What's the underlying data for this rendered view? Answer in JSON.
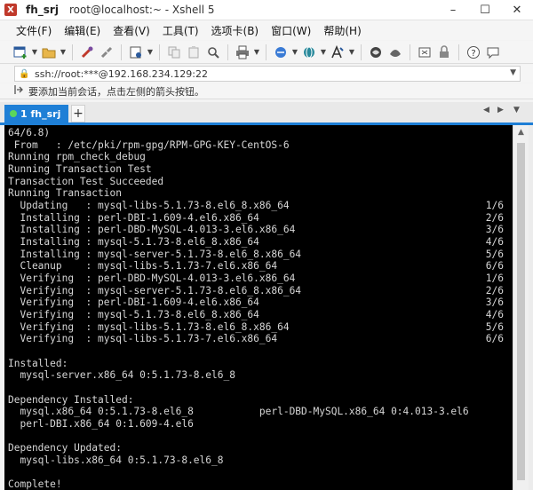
{
  "titlebar": {
    "session": "fh_srj",
    "title": "root@localhost:~ - Xshell 5",
    "minimize": "–",
    "maximize": "☐",
    "close": "✕"
  },
  "menubar": [
    "文件(F)",
    "编辑(E)",
    "查看(V)",
    "工具(T)",
    "选项卡(B)",
    "窗口(W)",
    "帮助(H)"
  ],
  "toolbar": {
    "icons": [
      "new-session-icon",
      "open-folder-icon",
      "reconnect-icon",
      "disconnect-icon",
      "properties-icon",
      "copy-icon",
      "paste-icon",
      "find-icon",
      "print-icon",
      "transfer-icon",
      "globe-icon",
      "font-icon",
      "xftp-icon",
      "xagent-icon",
      "fullscreen-icon",
      "lock-icon",
      "help-icon",
      "chat-icon"
    ]
  },
  "address": {
    "value": "ssh://root:***@192.168.234.129:22"
  },
  "hint": {
    "text": "要添加当前会话，点击左侧的箭头按钮。"
  },
  "tabs": {
    "active_label": "1 fh_srj",
    "add": "+",
    "prev": "◀",
    "next": "▶",
    "menu": "▼"
  },
  "terminal": {
    "lines": [
      "64/6.8)",
      " From   : /etc/pki/rpm-gpg/RPM-GPG-KEY-CentOS-6",
      "Running rpm_check_debug",
      "Running Transaction Test",
      "Transaction Test Succeeded",
      "Running Transaction",
      "  Updating   : mysql-libs-5.1.73-8.el6_8.x86_64",
      "  Installing : perl-DBI-1.609-4.el6.x86_64",
      "  Installing : perl-DBD-MySQL-4.013-3.el6.x86_64",
      "  Installing : mysql-5.1.73-8.el6_8.x86_64",
      "  Installing : mysql-server-5.1.73-8.el6_8.x86_64",
      "  Cleanup    : mysql-libs-5.1.73-7.el6.x86_64",
      "  Verifying  : perl-DBD-MySQL-4.013-3.el6.x86_64",
      "  Verifying  : mysql-server-5.1.73-8.el6_8.x86_64",
      "  Verifying  : perl-DBI-1.609-4.el6.x86_64",
      "  Verifying  : mysql-5.1.73-8.el6_8.x86_64",
      "  Verifying  : mysql-libs-5.1.73-8.el6_8.x86_64",
      "  Verifying  : mysql-libs-5.1.73-7.el6.x86_64",
      "",
      "Installed:",
      "  mysql-server.x86_64 0:5.1.73-8.el6_8",
      "",
      "Dependency Installed:",
      "  mysql.x86_64 0:5.1.73-8.el6_8           perl-DBD-MySQL.x86_64 0:4.013-3.el6",
      "  perl-DBI.x86_64 0:1.609-4.el6",
      "",
      "Dependency Updated:",
      "  mysql-libs.x86_64 0:5.1.73-8.el6_8",
      "",
      "Complete!"
    ],
    "progress": [
      "1/6",
      "2/6",
      "3/6",
      "4/6",
      "5/6",
      "6/6",
      "1/6",
      "2/6",
      "3/6",
      "4/6",
      "5/6",
      "6/6"
    ]
  },
  "scrollbar": {
    "up": "▲"
  }
}
